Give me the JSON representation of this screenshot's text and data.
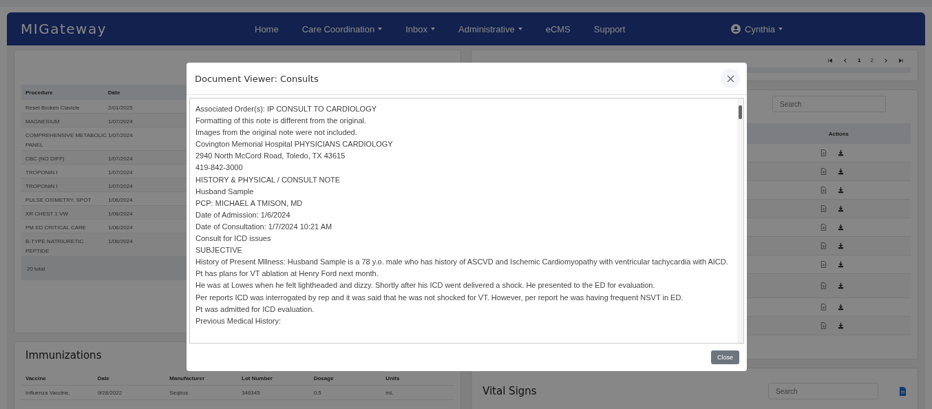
{
  "navbar": {
    "logo": "MIGateway",
    "items": [
      {
        "label": "Home",
        "dropdown": false
      },
      {
        "label": "Care Coordination",
        "dropdown": true
      },
      {
        "label": "Inbox",
        "dropdown": true
      },
      {
        "label": "Administrative",
        "dropdown": true
      },
      {
        "label": "eCMS",
        "dropdown": false
      },
      {
        "label": "Support",
        "dropdown": false
      }
    ],
    "user": {
      "label": "Cynthia",
      "dropdown": true
    }
  },
  "procedures": {
    "columns": [
      "Procedure",
      "Date"
    ],
    "rows": [
      {
        "procedure": "Reset Broken Clavicle",
        "date": "2/01/2025"
      },
      {
        "procedure": "MAGNESIUM",
        "date": "1/07/2024"
      },
      {
        "procedure": "COMPREHENSIVE METABOLIC PANEL",
        "date": "1/07/2024"
      },
      {
        "procedure": "CBC (NO DIFF)",
        "date": "1/07/2024"
      },
      {
        "procedure": "TROPONIN I",
        "date": "1/07/2024"
      },
      {
        "procedure": "TROPONIN I",
        "date": "1/07/2024"
      },
      {
        "procedure": "PULSE OXIMETRY, SPOT",
        "date": "1/06/2024"
      },
      {
        "procedure": "XR CHEST 1 VW",
        "date": "1/06/2024"
      },
      {
        "procedure": "PM ED CRITICAL CARE",
        "date": "1/06/2024"
      },
      {
        "procedure": "B-TYPE NATRIURETIC PEPTIDE",
        "date": "1/06/2024"
      }
    ],
    "footer": "20 total"
  },
  "immunizations": {
    "title": "Immunizations",
    "columns": [
      "Vaccine",
      "Date",
      "Manufacturer",
      "Lot Number",
      "Dosage",
      "Units"
    ],
    "rows": [
      [
        "Influenza Vaccine,",
        "9/28/2022",
        "Seqirus",
        "346345",
        "0.5",
        "mL"
      ]
    ]
  },
  "documents": {
    "pages": [
      {
        "label": "1",
        "selected": true
      },
      {
        "label": "2",
        "selected": false
      }
    ],
    "search": {
      "placeholder": "Search"
    },
    "actions_header": "Actions"
  },
  "vital_signs": {
    "title": "Vital Signs",
    "search": {
      "placeholder": "Search"
    }
  },
  "modal": {
    "title": "Document Viewer: Consults",
    "lines": [
      " Associated Order(s): IP CONSULT TO CARDIOLOGY",
      "Formatting of this note is different from the original.",
      "Images from the original note were not included.",
      "Covington Memorial Hospital PHYSICIANS CARDIOLOGY",
      "2940 North McCord Road, Toledo, TX 43615",
      "419-842-3000",
      "HISTORY & PHYSICAL / CONSULT NOTE",
      "Husband Sample",
      "PCP:  MICHAEL A TMISON, MD",
      "Date of Admission:  1/6/2024",
      "Date of Consultation:  1/7/2024 10:21 AM",
      "Consult for ICD issues",
      "SUBJECTIVE",
      "History of Present Mllness:  Husband Sample is a 78 y.o. male who has history of ASCVD and Ischemic Cardiomyopathy with ventricular tachycardia with AICD.",
      "Pt has plans for VT ablation at Henry Ford next month.",
      "He was at Lowes when he felt lightheaded and dizzy. Shortly after his ICD went delivered a shock. He presented to the ED for evaluation.",
      "Per reports ICD was interrogated by rep and it was said that he was not shocked for VT. However, per report he was having frequent NSVT in ED.",
      "Pt was admitted for ICD evaluation.",
      "Previous Medical History:"
    ],
    "close_label": "Close"
  }
}
